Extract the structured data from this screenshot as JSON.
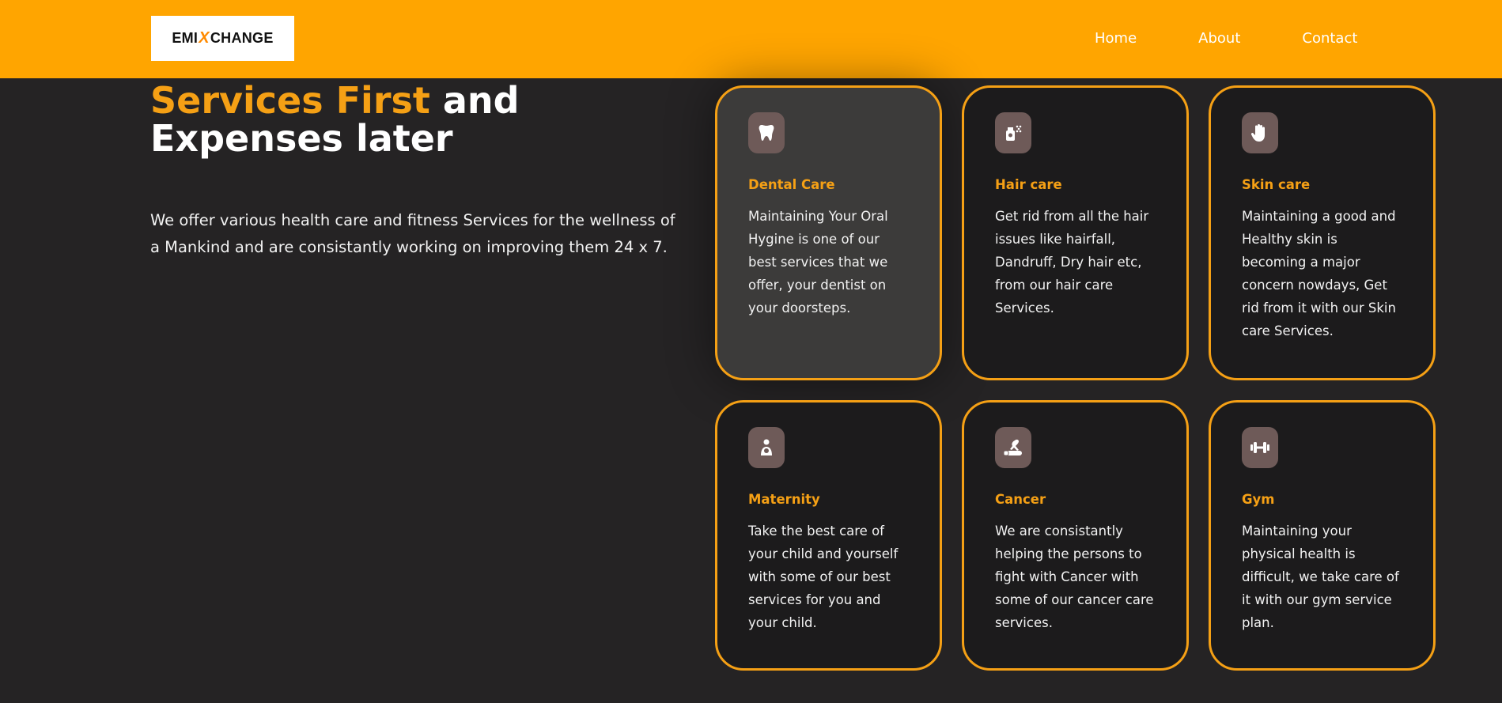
{
  "header": {
    "logo": {
      "part1": "EMI",
      "mark": "X",
      "part2": "CHANGE"
    },
    "nav": [
      "Home",
      "About",
      "Contact"
    ]
  },
  "hero": {
    "title_accent": "Services First",
    "title_rest_line1": " and",
    "title_line2": "Expenses later",
    "description": "We offer various health care and fitness Services for the wellness of a Mankind and are consistantly working on improving them 24 x 7."
  },
  "services": [
    {
      "icon": "tooth-icon",
      "title": "Dental Care",
      "text": "Maintaining Your Oral Hygine is one of our best services that we offer, your dentist on your doorsteps."
    },
    {
      "icon": "spray-bottle-icon",
      "title": "Hair care",
      "text": "Get rid from all the hair issues like hairfall, Dandruff, Dry hair etc, from our hair care Services."
    },
    {
      "icon": "hand-sparkle-icon",
      "title": "Skin care",
      "text": "Maintaining a good and Healthy skin is becoming a major concern nowdays, Get rid from it with our Skin care Services."
    },
    {
      "icon": "mother-child-icon",
      "title": "Maternity",
      "text": "Take the best care of your child and yourself with some of our best services for you and your child."
    },
    {
      "icon": "ribbon-hand-icon",
      "title": "Cancer",
      "text": "We are consistantly helping the persons to fight with Cancer with some of our cancer care services."
    },
    {
      "icon": "dumbbell-icon",
      "title": "Gym",
      "text": "Maintaining your physical health is difficult, we take care of it with our gym service plan."
    }
  ],
  "colors": {
    "accent": "#f5a015",
    "header": "#ffa500",
    "background": "#252324",
    "icon_bg": "#6e5a58"
  }
}
